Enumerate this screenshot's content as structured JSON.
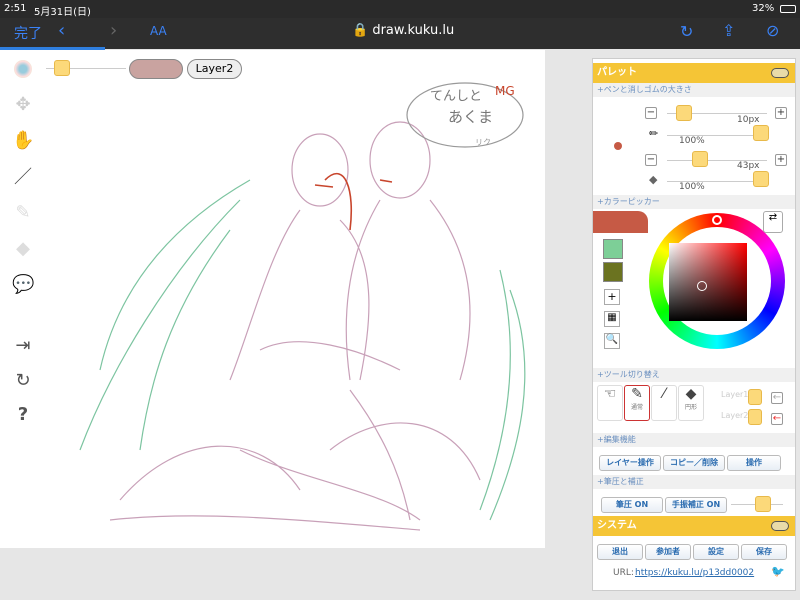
{
  "status": {
    "time": "2:51",
    "date": "5月31日(日)",
    "battery": "32%"
  },
  "browser": {
    "done": "完了",
    "text_size": "AA",
    "url": "draw.kuku.lu",
    "load_progress": 0.13
  },
  "canvas_toolbar": {
    "layer_button": "Layer2",
    "current_color": "#c9a3a0"
  },
  "sketch_text": {
    "speech1": "てんしと",
    "speech2": "あくま",
    "tag": "MG",
    "small": "リク"
  },
  "palette": {
    "title": "パレット",
    "size_section": "+ペンと消しゴムの大きさ",
    "pen": {
      "size": "10px",
      "opacity": "100%"
    },
    "eraser": {
      "size": "43px",
      "opacity": "100%"
    },
    "picker_section": "+カラーピッカー",
    "current_color": "#c65a45",
    "swatches": [
      "#7dcf97",
      "#6b7320"
    ],
    "tool_section": "+ツール切り替え",
    "tools": [
      {
        "icon": "hand-icon",
        "label": ""
      },
      {
        "icon": "pen-icon",
        "label": "通常"
      },
      {
        "icon": "dropper-icon",
        "label": ""
      },
      {
        "icon": "eraser-icon",
        "label": "円形"
      }
    ],
    "layers": [
      "Layer1",
      "Layer2"
    ],
    "edit_section": "+編集機能",
    "edit_buttons": [
      "レイヤー操作",
      "コピー／削除",
      "操作"
    ],
    "pressure_section": "+筆圧と補正",
    "pressure_buttons": [
      "筆圧 ON",
      "手振補正 ON"
    ]
  },
  "system": {
    "title": "システム",
    "buttons": [
      "退出",
      "参加者",
      "設定",
      "保存"
    ],
    "url_label": "URL:",
    "url": "https://kuku.lu/p13dd0002"
  }
}
